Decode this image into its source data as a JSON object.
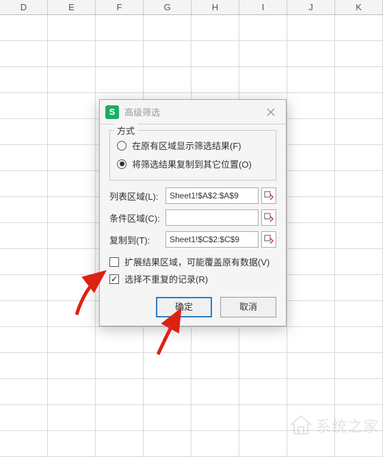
{
  "columns": [
    "D",
    "E",
    "F",
    "G",
    "H",
    "I",
    "J",
    "K"
  ],
  "dialog": {
    "app_icon_letter": "S",
    "title": "高级筛选",
    "fieldset_legend": "方式",
    "radio_in_place": "在原有区域显示筛选结果(F)",
    "radio_copy": "将筛选结果复制到其它位置(O)",
    "selected_radio": "copy",
    "list_range_label": "列表区域(L):",
    "list_range_value": "Sheet1!$A$2:$A$9",
    "criteria_label": "条件区域(C):",
    "criteria_value": "",
    "copy_to_label": "复制到(T):",
    "copy_to_value": "Sheet1!$C$2:$C$9",
    "chk_extend_label": "扩展结果区域，可能覆盖原有数据(V)",
    "chk_extend_checked": false,
    "chk_unique_label": "选择不重复的记录(R)",
    "chk_unique_checked": true,
    "ok_label": "确定",
    "cancel_label": "取消"
  },
  "watermark": {
    "text": "系统之家"
  }
}
